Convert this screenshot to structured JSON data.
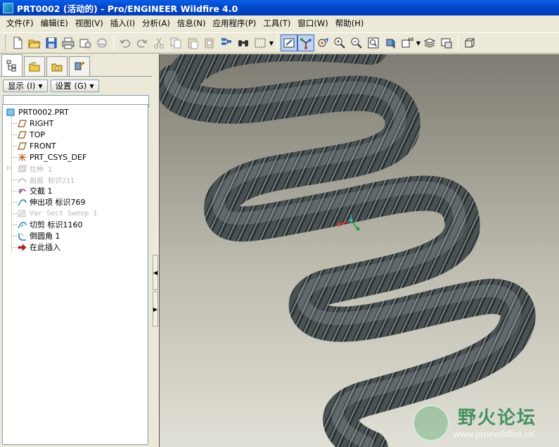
{
  "window": {
    "title": "PRT0002 (活动的) - Pro/ENGINEER Wildfire 4.0"
  },
  "menu": [
    "文件(F)",
    "编辑(E)",
    "视图(V)",
    "插入(I)",
    "分析(A)",
    "信息(N)",
    "应用程序(P)",
    "工具(T)",
    "窗口(W)",
    "帮助(H)"
  ],
  "toolbar": {
    "icons": [
      "new-icon",
      "open-icon",
      "save-icon",
      "print-icon",
      "send-icon",
      "plot-icon",
      "undo-icon",
      "redo-icon",
      "cut-icon",
      "copy-icon",
      "paste-icon",
      "paste-special-icon",
      "regenerate-icon",
      "find-icon",
      "selection-filter-icon",
      "repaint-icon",
      "spin-center-icon",
      "orient-mode-icon",
      "zoom-in-icon",
      "zoom-out-icon",
      "refit-icon",
      "reorient-icon",
      "saved-views-icon",
      "layers-icon",
      "view-manager-icon",
      "display-style-icon"
    ],
    "active": [
      "repaint-icon",
      "spin-center-icon"
    ]
  },
  "panel": {
    "show_label": "显示",
    "show_key": "(I)",
    "settings_label": "设置",
    "settings_key": "(G)",
    "tree": [
      {
        "label": "PRT0002.PRT",
        "icon": "part-icon",
        "dim": false
      },
      {
        "label": "RIGHT",
        "icon": "datum-plane-icon",
        "dim": false
      },
      {
        "label": "TOP",
        "icon": "datum-plane-icon",
        "dim": false
      },
      {
        "label": "FRONT",
        "icon": "datum-plane-icon",
        "dim": false
      },
      {
        "label": "PRT_CSYS_DEF",
        "icon": "csys-icon",
        "dim": false
      },
      {
        "label": "拉伸 1",
        "icon": "extrude-icon",
        "dim": true
      },
      {
        "label": "曲面 标识211",
        "icon": "surface-icon",
        "dim": true
      },
      {
        "label": "交截 1",
        "icon": "intersect-icon",
        "dim": false
      },
      {
        "label": "伸出项 标识769",
        "icon": "protrusion-icon",
        "dim": false
      },
      {
        "label": "Var Sect Sweep 1",
        "icon": "vss-icon",
        "dim": true
      },
      {
        "label": "切剪 标识1160",
        "icon": "cut-icon",
        "dim": false
      },
      {
        "label": "倒圆角 1",
        "icon": "round-icon",
        "dim": false
      },
      {
        "label": "在此插入",
        "icon": "insert-here-icon",
        "dim": false
      }
    ]
  },
  "watermark": {
    "title": "野火论坛",
    "url": "www.proewildfire.cn"
  }
}
